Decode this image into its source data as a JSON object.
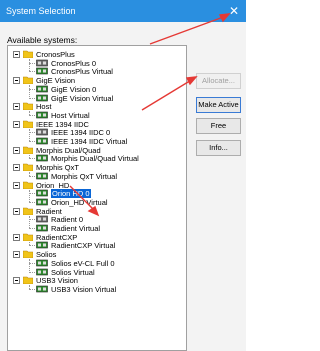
{
  "window": {
    "title": "System Selection"
  },
  "label": "Available systems:",
  "buttons": {
    "allocate": "Allocate...",
    "make_active": "Make Active",
    "free": "Free",
    "info": "Info..."
  },
  "tree": [
    {
      "label": "CronosPlus",
      "children": [
        {
          "label": "CronosPlus 0",
          "icon": "camera-board-gray"
        },
        {
          "label": "CronosPlus Virtual",
          "icon": "camera-board-green"
        }
      ]
    },
    {
      "label": "GigE Vision",
      "children": [
        {
          "label": "GigE Vision 0",
          "icon": "camera-board-green"
        },
        {
          "label": "GigE Vision Virtual",
          "icon": "camera-board-green"
        }
      ]
    },
    {
      "label": "Host",
      "children": [
        {
          "label": "Host Virtual",
          "icon": "camera-board-green"
        }
      ]
    },
    {
      "label": "IEEE 1394 IIDC",
      "children": [
        {
          "label": "IEEE 1394 IIDC 0",
          "icon": "camera-board-gray"
        },
        {
          "label": "IEEE 1394 IIDC Virtual",
          "icon": "camera-board-green"
        }
      ]
    },
    {
      "label": "Morphis Dual/Quad",
      "children": [
        {
          "label": "Morphis Dual/Quad Virtual",
          "icon": "camera-board-green"
        }
      ]
    },
    {
      "label": "Morphis QxT",
      "children": [
        {
          "label": "Morphis QxT Virtual",
          "icon": "camera-board-green"
        }
      ]
    },
    {
      "label": "Orion_HD",
      "children": [
        {
          "label": "Orion HD 0",
          "icon": "camera-board-green",
          "selected": true
        },
        {
          "label": "Orion_HD Virtual",
          "icon": "camera-board-green"
        }
      ]
    },
    {
      "label": "Radient",
      "children": [
        {
          "label": "Radient 0",
          "icon": "camera-board-gray"
        },
        {
          "label": "Radient Virtual",
          "icon": "camera-board-green"
        }
      ]
    },
    {
      "label": "RadientCXP",
      "children": [
        {
          "label": "RadientCXP Virtual",
          "icon": "camera-board-green"
        }
      ]
    },
    {
      "label": "Solios",
      "children": [
        {
          "label": "Solios eV-CL Full 0",
          "icon": "camera-board-green"
        },
        {
          "label": "Solios Virtual",
          "icon": "camera-board-green"
        }
      ]
    },
    {
      "label": "USB3 Vision",
      "children": [
        {
          "label": "USB3 Vision Virtual",
          "icon": "camera-board-green"
        }
      ]
    }
  ],
  "colors": {
    "titlebar": "#2a8fe0",
    "selection": "#0a66d6",
    "annotation": "#e53935"
  }
}
